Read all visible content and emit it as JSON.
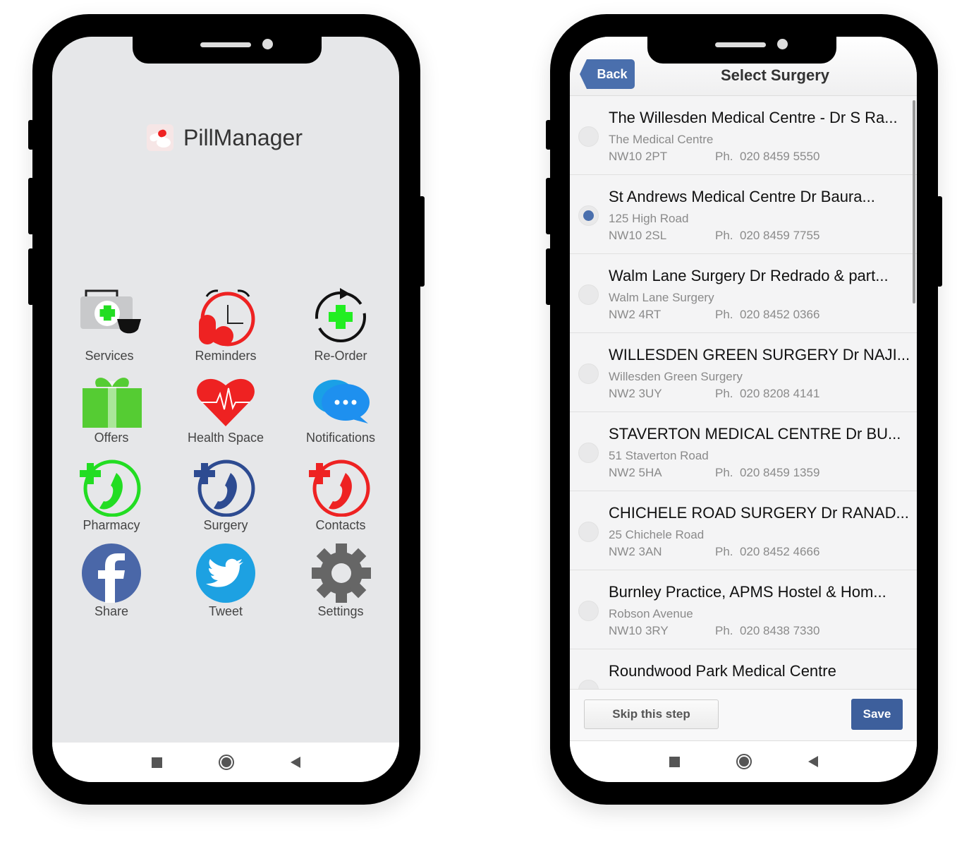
{
  "home": {
    "app_title": "PillManager",
    "tiles": [
      {
        "label": "Services",
        "icon": "medical-kit-icon"
      },
      {
        "label": "Reminders",
        "icon": "alarm-clock-pills-icon"
      },
      {
        "label": "Re-Order",
        "icon": "reorder-cycle-icon"
      },
      {
        "label": "Offers",
        "icon": "gift-icon"
      },
      {
        "label": "Health Space",
        "icon": "heart-pulse-icon"
      },
      {
        "label": "Notifications",
        "icon": "chat-bubbles-icon"
      },
      {
        "label": "Pharmacy",
        "icon": "phone-plus-green-icon"
      },
      {
        "label": "Surgery",
        "icon": "phone-plus-blue-icon"
      },
      {
        "label": "Contacts",
        "icon": "phone-plus-red-icon"
      },
      {
        "label": "Share",
        "icon": "facebook-icon"
      },
      {
        "label": "Tweet",
        "icon": "twitter-icon"
      },
      {
        "label": "Settings",
        "icon": "gear-icon"
      }
    ]
  },
  "select": {
    "back_label": "Back",
    "title": "Select Surgery",
    "items": [
      {
        "name": "The Willesden Medical Centre - Dr S Ra...",
        "sub": "The Medical Centre",
        "postcode": "NW10 2PT",
        "phone": "Ph.  020 8459 5550",
        "selected": false
      },
      {
        "name": "St Andrews Medical Centre  Dr Baura...",
        "sub": "125 High Road",
        "postcode": "NW10 2SL",
        "phone": "Ph.  020 8459 7755",
        "selected": true
      },
      {
        "name": "Walm Lane Surgery Dr Redrado & part...",
        "sub": "Walm Lane Surgery",
        "postcode": "NW2 4RT",
        "phone": "Ph.  020 8452 0366",
        "selected": false
      },
      {
        "name": "WILLESDEN GREEN SURGERY Dr NAJI...",
        "sub": "Willesden Green Surgery",
        "postcode": "NW2 3UY",
        "phone": "Ph.  020 8208 4141",
        "selected": false
      },
      {
        "name": "STAVERTON MEDICAL CENTRE Dr BU...",
        "sub": "51 Staverton Road",
        "postcode": "NW2 5HA",
        "phone": "Ph.  020 8459 1359",
        "selected": false
      },
      {
        "name": "CHICHELE ROAD SURGERY Dr RANAD...",
        "sub": "25 Chichele Road",
        "postcode": "NW2 3AN",
        "phone": "Ph.  020 8452 4666",
        "selected": false
      },
      {
        "name": "Burnley Practice, APMS Hostel & Hom...",
        "sub": "Robson Avenue",
        "postcode": "NW10 3RY",
        "phone": "Ph.  020 8438 7330",
        "selected": false
      },
      {
        "name": "Roundwood Park Medical Centre",
        "sub": "",
        "postcode": "",
        "phone": "",
        "selected": false
      }
    ],
    "skip_label": "Skip this step",
    "save_label": "Save",
    "accent": "#4a6fad"
  }
}
